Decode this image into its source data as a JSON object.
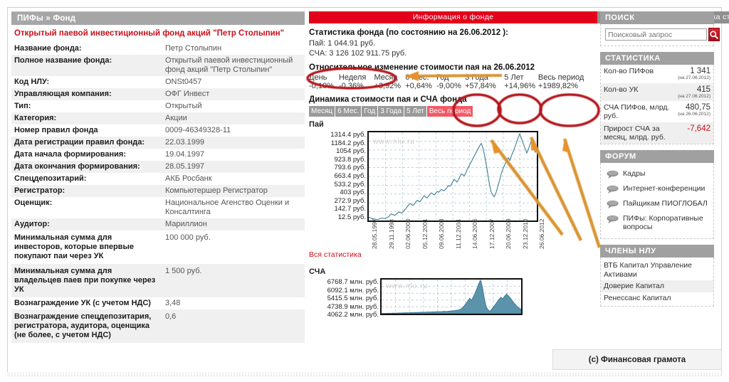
{
  "breadcrumb": "ПИФы » Фонд",
  "page_title": "Открытый паевой инвестиционный фонд акций \"Петр Столыпин\"",
  "tabs": [
    {
      "label": "Информация о фонде",
      "active": true
    },
    {
      "label": "Статистика стоимости пая и СЧА",
      "active": false
    }
  ],
  "colors": {
    "accent_red": "#e3001b",
    "title_red": "#c5121c",
    "header_gray": "#a0a0a0",
    "annotation_red": "#b4151c",
    "annotation_orange": "#e8902a",
    "chart_line": "#3e7d94"
  },
  "fund_info": {
    "rows": [
      {
        "key": "Название фонда:",
        "value": "Петр Столыпин"
      },
      {
        "key": "Полное название фонда:",
        "value": "Открытый паевой инвестиционный фонд акций \"Петр Столыпин\""
      },
      {
        "key": "Код НЛУ:",
        "value": "ONSt0457"
      },
      {
        "key": "Управляющая компания:",
        "value": "ОФГ Инвест"
      },
      {
        "key": "Тип:",
        "value": "Открытый"
      },
      {
        "key": "Категория:",
        "value": "Акции"
      },
      {
        "key": "Номер правил фонда",
        "value": "0009-46349328-11"
      },
      {
        "key": "Дата регистрации правил фонда:",
        "value": "22.03.1999"
      },
      {
        "key": "Дата начала формирования:",
        "value": "19.04.1997"
      },
      {
        "key": "Дата окончания формирования:",
        "value": "28.05.1997"
      },
      {
        "key": "Спецдепозитарий:",
        "value": "АКБ Росбанк"
      },
      {
        "key": "Регистратор:",
        "value": "Компьютершер Регистратор"
      },
      {
        "key": "Оценщик:",
        "value": "Национальное Агенство Оценки и Консалтинга"
      },
      {
        "key": "Аудитор:",
        "value": "Мариллион"
      },
      {
        "key": "Минимальная сумма для инвесторов, которые впервые покупают паи через УК",
        "value": "100 000 руб."
      },
      {
        "key": "Минимальная сумма для владельцев паев при покупке через УК",
        "value": "1 500 руб."
      },
      {
        "key": "Вознаграждение УК (с учетом НДС)",
        "value": "3,48"
      },
      {
        "key": "Вознаграждение спецдепозитария, регистратора, аудитора, оценщика (не более, с учетом НДС)",
        "value": "0,6"
      }
    ]
  },
  "statistics": {
    "heading": "Статистика фонда (по состоянию на 26.06.2012 ):",
    "pay_line": "Пай: 1 044.91 руб.",
    "scha_line": "СЧА: 3 126 102 911.75 руб.",
    "change_heading": "Относительное изменение стоимости пая на 26.06.2012",
    "change_columns": [
      "День",
      "Неделя",
      "Месяц",
      "6 Мес.",
      "Год",
      "3 Года",
      "5 Лет",
      "Весь период"
    ],
    "change_values": [
      "-0,10%",
      "-0,36%",
      "+3,92%",
      "+0,64%",
      "-9,00%",
      "+57,84%",
      "+14,96%",
      "+1989,82%"
    ]
  },
  "dynamics": {
    "heading": "Динамика стоимости пая и СЧА фонда",
    "periods": [
      {
        "label": "Месяц",
        "active": false
      },
      {
        "label": "6 Мес.",
        "active": false
      },
      {
        "label": "Год",
        "active": false
      },
      {
        "label": "3 Года",
        "active": false
      },
      {
        "label": "5 Лет",
        "active": false
      },
      {
        "label": "Весь период",
        "active": true
      }
    ],
    "all_stats_link": "Вся статистика"
  },
  "chart_data": [
    {
      "type": "line",
      "title": "Пай",
      "watermark": "www.nlu.ru",
      "ylabel": "руб.",
      "xlabel": "",
      "ytick_labels": [
        "1314.4 руб.",
        "1184.2 руб.",
        "1054 руб.",
        "923.8 руб.",
        "793.6 руб.",
        "663.4 руб.",
        "533.2 руб.",
        "403 руб.",
        "272.9 руб.",
        "142.7 руб.",
        "12.5 руб."
      ],
      "ytick_values": [
        1314.4,
        1184.2,
        1054,
        923.8,
        793.6,
        663.4,
        533.2,
        403,
        272.9,
        142.7,
        12.5
      ],
      "ylim": [
        12.5,
        1314.4
      ],
      "xtick_labels": [
        "28.05.1997",
        "29.11.1998",
        "02.06.2000",
        "05.12.2001",
        "09.06.2003",
        "11.12.2004",
        "14.06.2006",
        "17.12.2007",
        "20.06.2009",
        "23.12.2010",
        "26.06.2012"
      ],
      "grid": true,
      "legend": "none",
      "series": [
        {
          "name": "Пай",
          "values": [
            60,
            52,
            45,
            40,
            35,
            30,
            28,
            33,
            42,
            50,
            44,
            40,
            48,
            58,
            70,
            95,
            110,
            98,
            90,
            100,
            120,
            138,
            130,
            122,
            140,
            165,
            190,
            215,
            240,
            262,
            250,
            236,
            255,
            285,
            310,
            300,
            290,
            320,
            355,
            380,
            360,
            345,
            370,
            400,
            420,
            405,
            390,
            415,
            440,
            430,
            448,
            470,
            460,
            452,
            478,
            500,
            530,
            520,
            545,
            585,
            620,
            600,
            580,
            615,
            660,
            700,
            690,
            670,
            710,
            760,
            800,
            840,
            880,
            920,
            960,
            1000,
            1040,
            1080,
            1120,
            1150,
            1095,
            1010,
            900,
            780,
            640,
            520,
            430,
            390,
            365,
            400,
            470,
            545,
            620,
            700,
            760,
            810,
            860,
            905,
            940,
            900,
            955,
            1010,
            1060,
            1120,
            1180,
            1240,
            1290,
            1240,
            1180,
            1120,
            1065,
            1010,
            1060,
            1120,
            1180,
            1130,
            1070,
            1020,
            1045
          ]
        }
      ]
    },
    {
      "type": "area",
      "title": "СЧА",
      "watermark": "www.nlu.ru",
      "ylabel": "млн. руб.",
      "ytick_labels": [
        "6768.7 млн. руб.",
        "6092.1 млн. руб.",
        "5415.5 млн. руб.",
        "4738.9 млн. руб.",
        "4062.2 млн. руб."
      ],
      "ytick_values": [
        6768.7,
        6092.1,
        5415.5,
        4738.9,
        4062.2
      ],
      "grid": true,
      "legend": "none",
      "series": [
        {
          "name": "СЧА",
          "values": [
            60,
            70,
            65,
            80,
            95,
            90,
            110,
            130,
            120,
            140,
            160,
            150,
            170,
            190,
            180,
            200,
            230,
            215,
            240,
            270,
            255,
            280,
            310,
            295,
            320,
            350,
            335,
            360,
            390,
            375,
            400,
            430,
            415,
            440,
            470,
            455,
            480,
            520,
            560,
            600,
            640,
            700,
            760,
            900,
            1200,
            1600,
            2100,
            2600,
            3100,
            2700,
            3400,
            4200,
            5100,
            6100,
            6700,
            5200,
            3000,
            1400,
            800,
            500,
            900,
            1400,
            1900,
            2400,
            2900,
            3300,
            3000,
            3500,
            3900,
            3600,
            3200,
            2700,
            2200,
            1800,
            1400,
            1100,
            900
          ]
        }
      ]
    }
  ],
  "sidebar": {
    "search": {
      "title": "ПОИСК",
      "placeholder": "Поисковый запрос",
      "button_icon": "search-icon"
    },
    "statistics": {
      "title": "СТАТИСТИКА",
      "rows": [
        {
          "label": "Кол-во ПИФов",
          "value": "1 341",
          "date": "(на 27.06.2012)",
          "negative": false
        },
        {
          "label": "Кол-во УК",
          "value": "415",
          "date": "(на 27.06.2012)",
          "negative": false
        },
        {
          "label": "СЧА ПИФов, млрд. руб.",
          "value": "480,75",
          "date": "(на 26.06.2012)",
          "negative": false
        },
        {
          "label": "Прирост СЧА за месяц, млрд. руб.",
          "value": "-7,642",
          "date": "",
          "negative": true
        }
      ]
    },
    "forum": {
      "title": "ФОРУМ",
      "items": [
        {
          "label": "Кадры",
          "icon": "speech-bubble-icon"
        },
        {
          "label": "Интернет-конференции",
          "icon": "speech-bubble-icon"
        },
        {
          "label": "Пайщикам ПИОГЛОБАЛ",
          "icon": "speech-bubble-icon"
        },
        {
          "label": "ПИФы: Корпоративные вопросы",
          "icon": "speech-bubble-icon"
        }
      ]
    },
    "members": {
      "title": "ЧЛЕНЫ НЛУ",
      "items": [
        "ВТБ Капитал Управление Активами",
        "Доверие Капитал",
        "Ренессанс Капитал"
      ]
    }
  },
  "copyright": "(c) Финансовая грамота",
  "annotations": {
    "circles": [
      {
        "name": "pay-value-circle",
        "target": "Пай: 1 044.91 руб."
      },
      {
        "name": "three-years-circle",
        "target": "3 Года +57,84%"
      },
      {
        "name": "five-years-circle",
        "target": "5 Лет +14,96%"
      },
      {
        "name": "all-period-circle",
        "target": "Весь период +1989,82%"
      }
    ],
    "arrows": [
      {
        "name": "arrow-to-pay-value",
        "direction": "left"
      },
      {
        "name": "arrow-to-three-years",
        "direction": "up-left"
      },
      {
        "name": "arrow-to-five-years",
        "direction": "up-left"
      },
      {
        "name": "arrow-to-all-period",
        "direction": "up-left"
      }
    ]
  }
}
